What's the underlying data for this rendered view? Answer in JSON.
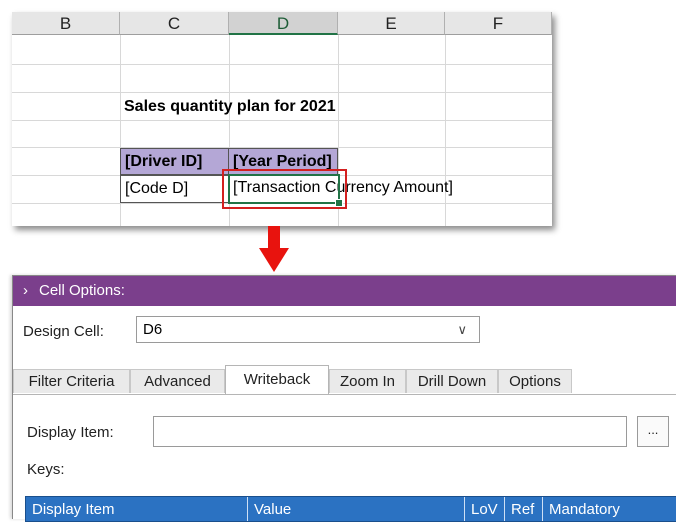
{
  "excel": {
    "columns": [
      "B",
      "C",
      "D",
      "E",
      "F"
    ],
    "title": "Sales quantity plan for 2021",
    "driver_id": "[Driver ID]",
    "year_period": "[Year Period]",
    "code_d": "[Code D]",
    "transaction_amount": "[Transaction Currency Amount]"
  },
  "panel": {
    "title": "Cell Options:",
    "design_cell_label": "Design Cell:",
    "design_cell_value": "D6",
    "tabs": [
      "Filter Criteria",
      "Advanced",
      "Writeback",
      "Zoom In",
      "Drill Down",
      "Options"
    ],
    "active_tab": "Writeback",
    "display_item_label": "Display Item:",
    "display_item_value": "",
    "browse_label": "...",
    "keys_label": "Keys:",
    "grid_columns": [
      "Display Item",
      "Value",
      "LoV",
      "Ref",
      "Mandatory"
    ]
  },
  "colors": {
    "panel_title_bg": "#7b3f8c",
    "grid_header_bg": "#2b72c2",
    "header_cell_fill": "#b4a7d6",
    "selection_green": "#217346",
    "highlight_red": "#d32020"
  },
  "icons": [
    "chevron-right-icon",
    "chevron-down-icon",
    "down-arrow-icon"
  ]
}
